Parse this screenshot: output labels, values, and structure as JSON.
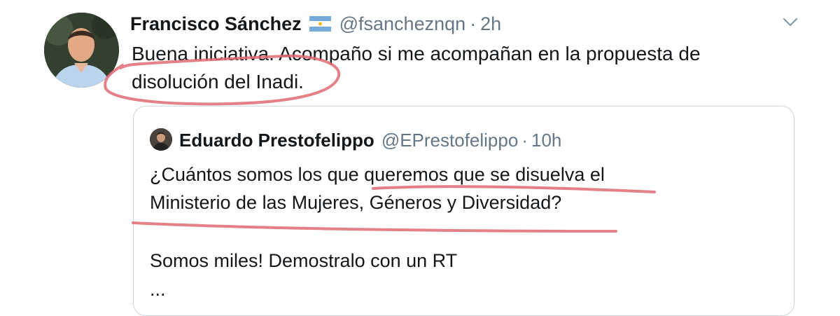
{
  "tweet": {
    "author_name": "Francisco Sánchez",
    "flag_icon": "argentina-flag-icon",
    "handle": "@fsancheznqn",
    "separator": "·",
    "time": "2h",
    "text_line1": "Buena iniciativa. Acompaño si me acompañan en la propuesta de",
    "text_line2": "disolución del Inadi."
  },
  "quoted_tweet": {
    "author_name": "Eduardo Prestofelippo",
    "handle": "@EPrestofelippo",
    "separator": "·",
    "time": "10h",
    "text_line1": "¿Cuántos somos los que queremos que se disuelva el",
    "text_line2": "Ministerio de las Mujeres, Géneros y Diversidad?",
    "text_line3": "Somos miles! Demostralo con un RT",
    "ellipsis": "..."
  },
  "colors": {
    "text": "#14171a",
    "secondary": "#657786",
    "border": "#ccd6dd",
    "annotation": "#e06a72"
  }
}
